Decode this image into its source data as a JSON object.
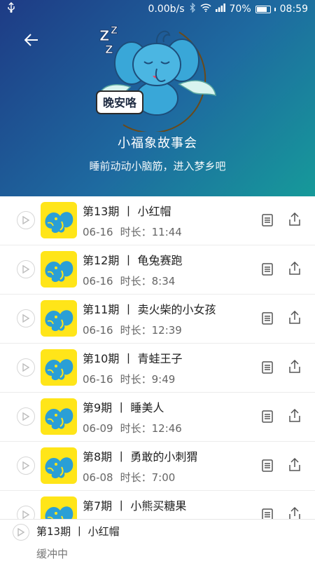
{
  "statusbar": {
    "network_speed": "0.00b/s",
    "battery_percent": "70%",
    "battery_level": 0.7,
    "time": "08:59",
    "icons": [
      "usb-icon",
      "bluetooth-icon",
      "wifi-icon",
      "signal-icon",
      "battery-icon"
    ]
  },
  "header": {
    "title": "小福象故事会",
    "subtitle": "睡前动动小脑筋，进入梦乡吧",
    "mascot_sign": "晚安咯",
    "gradient": [
      "#1e3b85",
      "#1e6aa0",
      "#169a9a"
    ]
  },
  "episodes": [
    {
      "title": "第13期 丨 小红帽",
      "date": "06-16",
      "duration_label": "时长：",
      "duration": "11:44"
    },
    {
      "title": "第12期 丨 龟兔赛跑",
      "date": "06-16",
      "duration_label": "时长：",
      "duration": "8:34"
    },
    {
      "title": "第11期 丨 卖火柴的小女孩",
      "date": "06-16",
      "duration_label": "时长：",
      "duration": "12:39"
    },
    {
      "title": "第10期 丨 青蛙王子",
      "date": "06-16",
      "duration_label": "时长：",
      "duration": "9:49"
    },
    {
      "title": "第9期 丨 睡美人",
      "date": "06-09",
      "duration_label": "时长：",
      "duration": "12:46"
    },
    {
      "title": "第8期 丨 勇敢的小刺猬",
      "date": "06-08",
      "duration_label": "时长：",
      "duration": "7:00"
    },
    {
      "title": "第7期 丨 小熊买糖果",
      "date": "",
      "duration_label": "",
      "duration": ""
    }
  ],
  "player": {
    "now_playing": "第13期 丨 小红帽",
    "status": "缓冲中"
  },
  "colors": {
    "thumb_bg": "#ffe519",
    "elephant_blue": "#2a9fd6"
  }
}
